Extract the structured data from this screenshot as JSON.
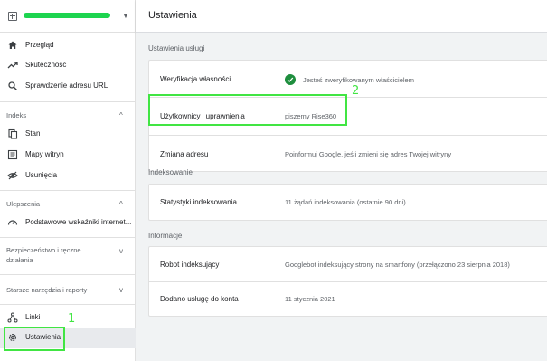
{
  "sidebar": {
    "property_caret": "▼",
    "nav": [
      {
        "label": "Przegląd",
        "icon": "home-icon"
      },
      {
        "label": "Skuteczność",
        "icon": "trending-up-icon"
      },
      {
        "label": "Sprawdzenie adresu URL",
        "icon": "search-icon"
      }
    ],
    "sections": [
      {
        "title": "Indeks",
        "chevron": "^",
        "items": [
          {
            "label": "Stan",
            "icon": "file-copy-icon"
          },
          {
            "label": "Mapy witryn",
            "icon": "sitemap-icon"
          },
          {
            "label": "Usunięcia",
            "icon": "visibility-off-icon"
          }
        ]
      },
      {
        "title": "Ulepszenia",
        "chevron": "^",
        "items": [
          {
            "label": "Podstawowe wskaźniki internet...",
            "icon": "speed-gauge-icon"
          }
        ]
      },
      {
        "title": "Bezpieczeństwo i ręczne działania",
        "chevron": "v",
        "items": []
      },
      {
        "title": "Starsze narzędzia i raporty",
        "chevron": "v",
        "items": []
      }
    ],
    "bottom": [
      {
        "label": "Linki",
        "icon": "links-network-icon"
      },
      {
        "label": "Ustawienia",
        "icon": "settings-gear-icon",
        "active": true
      }
    ]
  },
  "header": {
    "title": "Ustawienia"
  },
  "main": {
    "service_settings": {
      "label": "Ustawienia usługi",
      "rows": [
        {
          "key": "Weryfikacja własności",
          "value": "Jesteś zweryfikowanym właścicielem"
        },
        {
          "key": "Użytkownicy i uprawnienia",
          "value": "piszemy Rise360"
        },
        {
          "key": "Zmiana adresu",
          "value": "Poinformuj Google, jeśli zmieni się adres Twojej witryny"
        }
      ]
    },
    "indexing": {
      "label": "Indeksowanie",
      "rows": [
        {
          "key": "Statystyki indeksowania",
          "value": "11 żądań indeksowania (ostatnie 90 dni)"
        }
      ]
    },
    "information": {
      "label": "Informacje",
      "rows": [
        {
          "key": "Robot indeksujący",
          "value": "Googlebot indeksujący strony na smartfony (przełączono 23 sierpnia 2018)"
        },
        {
          "key": "Dodano usługę do konta",
          "value": "11 stycznia 2021"
        }
      ]
    }
  },
  "annotations": {
    "one": "1",
    "two": "2"
  },
  "colors": {
    "highlight": "#41e543",
    "check": "#1e8e3e",
    "redaction": "#1dd44f"
  }
}
